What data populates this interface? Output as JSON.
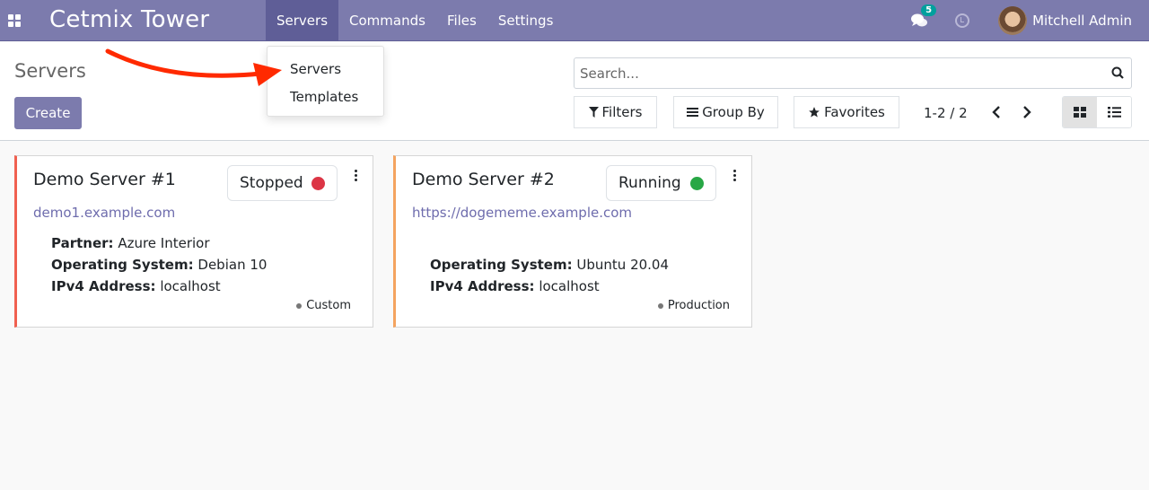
{
  "navbar": {
    "brand": "Cetmix Tower",
    "menu": [
      {
        "label": "Servers",
        "active": true
      },
      {
        "label": "Commands",
        "active": false
      },
      {
        "label": "Files",
        "active": false
      },
      {
        "label": "Settings",
        "active": false
      }
    ],
    "chat_badge": "5",
    "user_name": "Mitchell Admin"
  },
  "dropdown": {
    "items": [
      "Servers",
      "Templates"
    ]
  },
  "control_panel": {
    "title": "Servers",
    "create_label": "Create",
    "search_placeholder": "Search...",
    "filters_label": "Filters",
    "groupby_label": "Group By",
    "favorites_label": "Favorites",
    "pager": "1-2 / 2"
  },
  "cards": [
    {
      "name": "Demo Server #1",
      "status": "Stopped",
      "status_color": "#dc3545",
      "accent_color": "#f06050",
      "url": "demo1.example.com",
      "fields": [
        {
          "label": "Partner:",
          "value": "Azure Interior"
        },
        {
          "label": "Operating System:",
          "value": "Debian 10"
        },
        {
          "label": "IPv4 Address:",
          "value": "localhost"
        }
      ],
      "tag": "Custom"
    },
    {
      "name": "Demo Server #2",
      "status": "Running",
      "status_color": "#28a745",
      "accent_color": "#f4a460",
      "url": "https://dogememe.example.com",
      "fields": [
        {
          "label": "Operating System:",
          "value": "Ubuntu 20.04"
        },
        {
          "label": "IPv4 Address:",
          "value": "localhost"
        }
      ],
      "tag": "Production"
    }
  ],
  "colors": {
    "brand": "#7c7bad",
    "brand_dark": "#5f5e97",
    "annotation_arrow": "#ff2a00"
  }
}
